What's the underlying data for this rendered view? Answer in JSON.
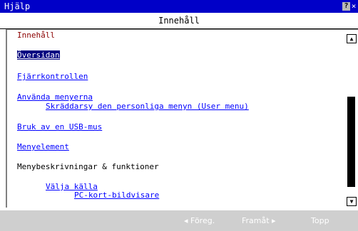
{
  "window": {
    "title": "Hjälp",
    "help_button": "?",
    "close_button": "×"
  },
  "header": {
    "title": "Innehåll"
  },
  "content": {
    "section_title": "Innehåll",
    "items": [
      {
        "label": "Översidan",
        "selected": true
      },
      {
        "label": "Fjärrkontrollen"
      },
      {
        "label": "Använda menyerna"
      },
      {
        "label": "Skräddarsy den personliga menyn (User menu)"
      },
      {
        "label": "Bruk av en USB-mus"
      },
      {
        "label": "Menyelement"
      },
      {
        "label": "Menybeskrivningar & funktioner"
      },
      {
        "label": "Välja källa"
      },
      {
        "label": "PC-kort-bildvisare"
      }
    ]
  },
  "scrollbar": {
    "up_icon": "▲",
    "down_icon": "▼"
  },
  "navigation": {
    "prev": "◂ Föreg.",
    "next": "Framåt ▸",
    "top": "Topp"
  },
  "colors": {
    "titlebar": "#0000c8",
    "link": "#0000ff",
    "selected_bg": "#000080",
    "section_title": "#8b0000",
    "bottombar": "#cfcfcf"
  }
}
